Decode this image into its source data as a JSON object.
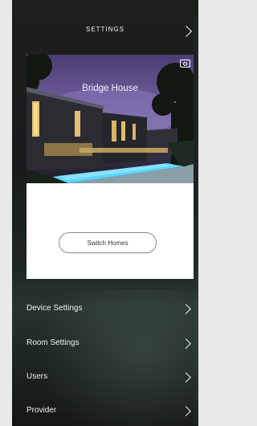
{
  "header": {
    "title": "SETTINGS",
    "chevron_icon": "chevron-right-icon"
  },
  "home": {
    "name": "Bridge House",
    "camera_icon": "camera-icon",
    "switch_label": "Switch Homes"
  },
  "menu": {
    "items": [
      {
        "label": "Device Settings",
        "icon": "chevron-right-icon"
      },
      {
        "label": "Room Settings",
        "icon": "chevron-right-icon"
      },
      {
        "label": "Users",
        "icon": "chevron-right-icon"
      },
      {
        "label": "Provider",
        "icon": "chevron-right-icon"
      }
    ]
  }
}
